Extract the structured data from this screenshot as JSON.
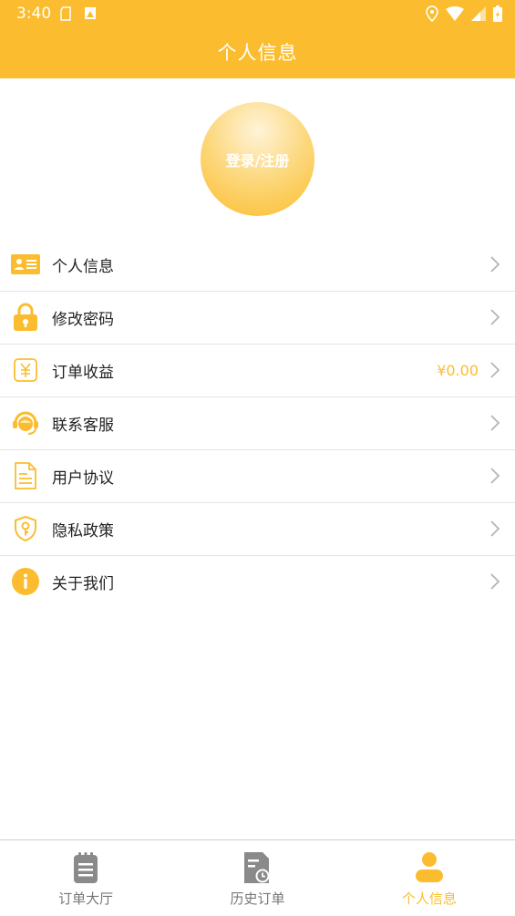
{
  "status_bar": {
    "time": "3:40"
  },
  "header": {
    "title": "个人信息"
  },
  "login": {
    "label": "登录/注册"
  },
  "menu": [
    {
      "label": "个人信息",
      "icon": "id-card-icon"
    },
    {
      "label": "修改密码",
      "icon": "lock-icon"
    },
    {
      "label": "订单收益",
      "icon": "yuan-icon",
      "value": "¥0.00"
    },
    {
      "label": "联系客服",
      "icon": "headset-icon"
    },
    {
      "label": "用户协议",
      "icon": "document-icon"
    },
    {
      "label": "隐私政策",
      "icon": "shield-icon"
    },
    {
      "label": "关于我们",
      "icon": "info-icon"
    }
  ],
  "tabs": [
    {
      "label": "订单大厅",
      "icon": "clipboard-icon",
      "active": false
    },
    {
      "label": "历史订单",
      "icon": "history-icon",
      "active": false
    },
    {
      "label": "个人信息",
      "icon": "person-icon",
      "active": true
    }
  ],
  "colors": {
    "accent": "#fbbd2f",
    "inactive": "#777777",
    "divider": "#e5e5e5"
  }
}
